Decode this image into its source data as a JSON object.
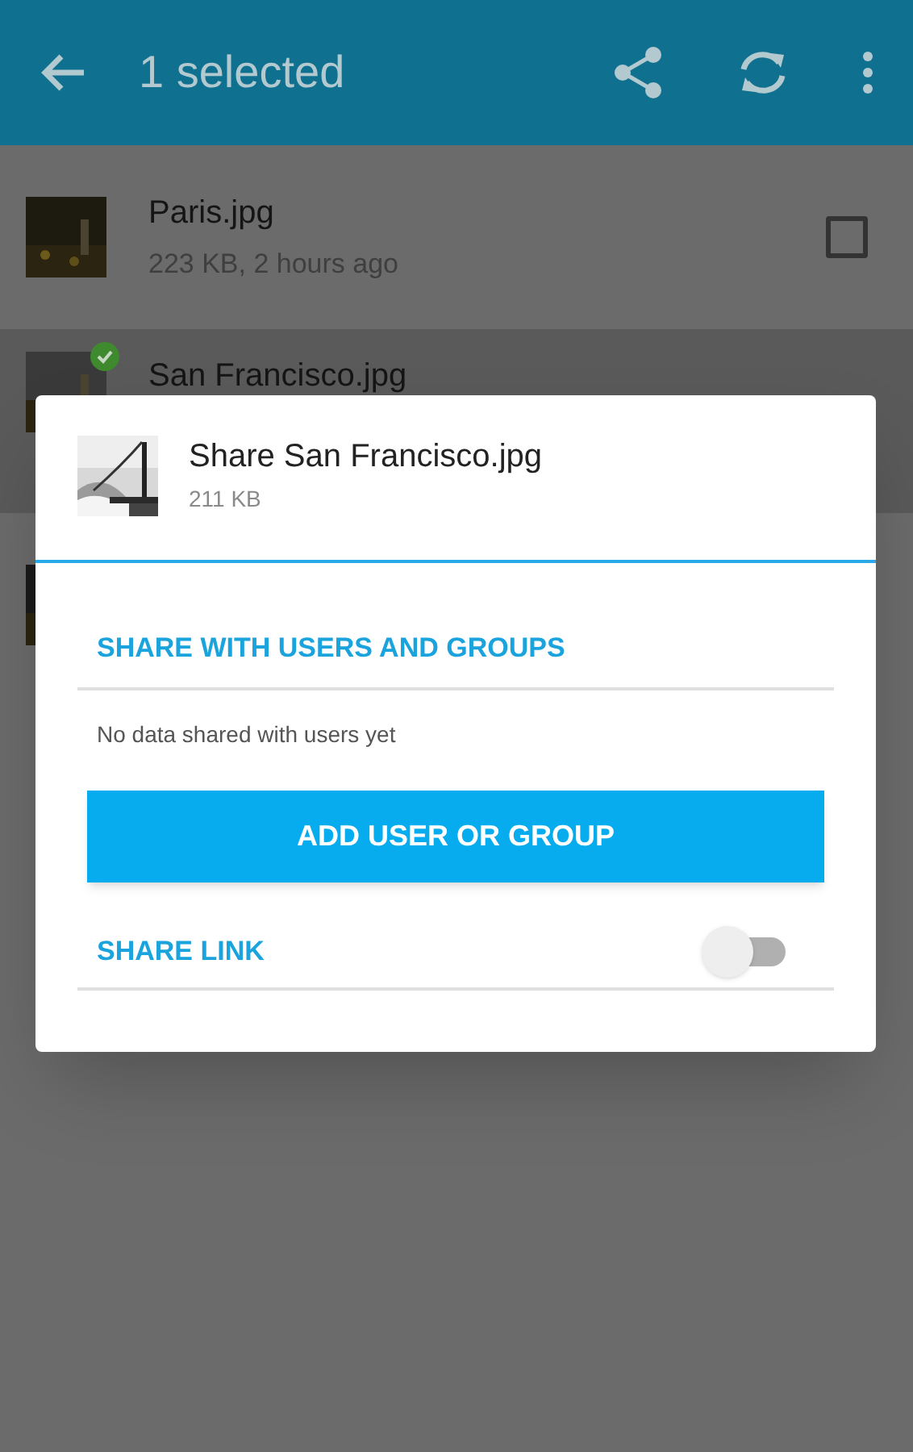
{
  "toolbar": {
    "title": "1 selected"
  },
  "files": [
    {
      "name": "Paris.jpg",
      "details": "223 KB, 2 hours ago",
      "selected": false
    },
    {
      "name": "San Francisco.jpg",
      "selected": true
    },
    {
      "selected": false
    }
  ],
  "dialog": {
    "title": "Share San Francisco.jpg",
    "size": "211 KB",
    "users_heading": "SHARE WITH USERS AND GROUPS",
    "empty_note": "No data shared with users yet",
    "add_button": "ADD USER OR GROUP",
    "share_link": {
      "label": "SHARE LINK",
      "on": false
    }
  }
}
